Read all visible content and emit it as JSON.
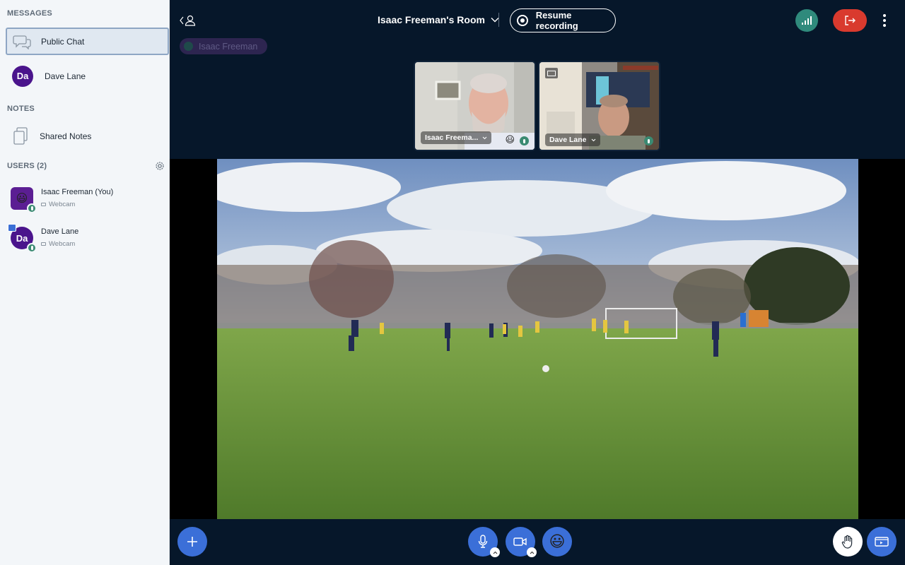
{
  "sidebar": {
    "messages_title": "MESSAGES",
    "public_chat": "Public Chat",
    "private_chat": {
      "initials": "Da",
      "name": "Dave Lane"
    },
    "notes_title": "NOTES",
    "shared_notes": "Shared Notes",
    "users_title": "USERS (2)",
    "users": [
      {
        "name": "Isaac Freeman (You)",
        "status": "Webcam",
        "avatar": "😃"
      },
      {
        "name": "Dave Lane",
        "status": "Webcam",
        "initials": "Da"
      }
    ]
  },
  "header": {
    "room_title": "Isaac Freeman's Room",
    "record_label": "Resume recording",
    "talking": "Isaac Freeman"
  },
  "videos": [
    {
      "name": "Isaac Freema...",
      "emoji": "😃"
    },
    {
      "name": "Dave Lane"
    }
  ],
  "toolbar": {
    "reaction_emoji": "😃"
  },
  "colors": {
    "accent": "#3b6fd8",
    "leave": "#d93a2e",
    "background": "#06172a",
    "sidebar": "#f3f6f9"
  }
}
